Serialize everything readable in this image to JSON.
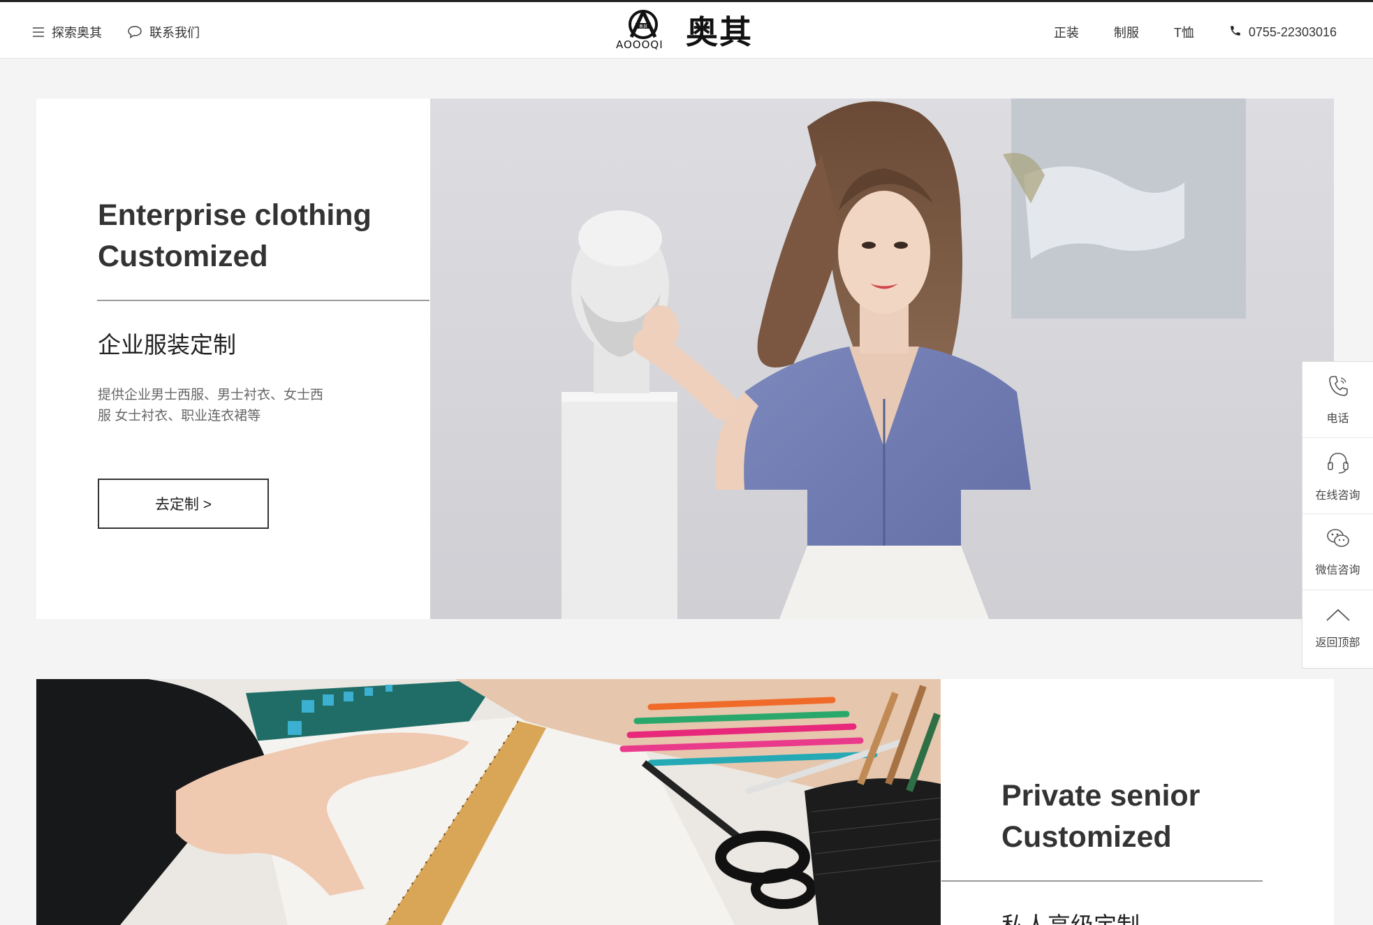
{
  "header": {
    "explore_label": "探索奥其",
    "contact_label": "联系我们",
    "logo_sub": "AOOOQI",
    "logo_text": "奥其",
    "nav": [
      {
        "label": "正装"
      },
      {
        "label": "制服"
      },
      {
        "label": "T恤"
      }
    ],
    "phone": "0755-22303016"
  },
  "section1": {
    "title_en_line1": "Enterprise clothing",
    "title_en_line2": "Customized",
    "title_cn": "企业服装定制",
    "desc_line1": "提供企业男士西服、男士衬衣、女士西",
    "desc_line2": "服 女士衬衣、职业连衣裙等",
    "button_label": "去定制 >"
  },
  "section2": {
    "title_en_line1": "Private senior",
    "title_en_line2": "Customized",
    "title_cn": "私人高级定制"
  },
  "sidebar": {
    "items": [
      {
        "label": "电话",
        "icon": "phone-icon"
      },
      {
        "label": "在线咨询",
        "icon": "headset-icon"
      },
      {
        "label": "微信咨询",
        "icon": "wechat-icon"
      },
      {
        "label": "返回顶部",
        "icon": "chevron-up-icon"
      }
    ]
  }
}
